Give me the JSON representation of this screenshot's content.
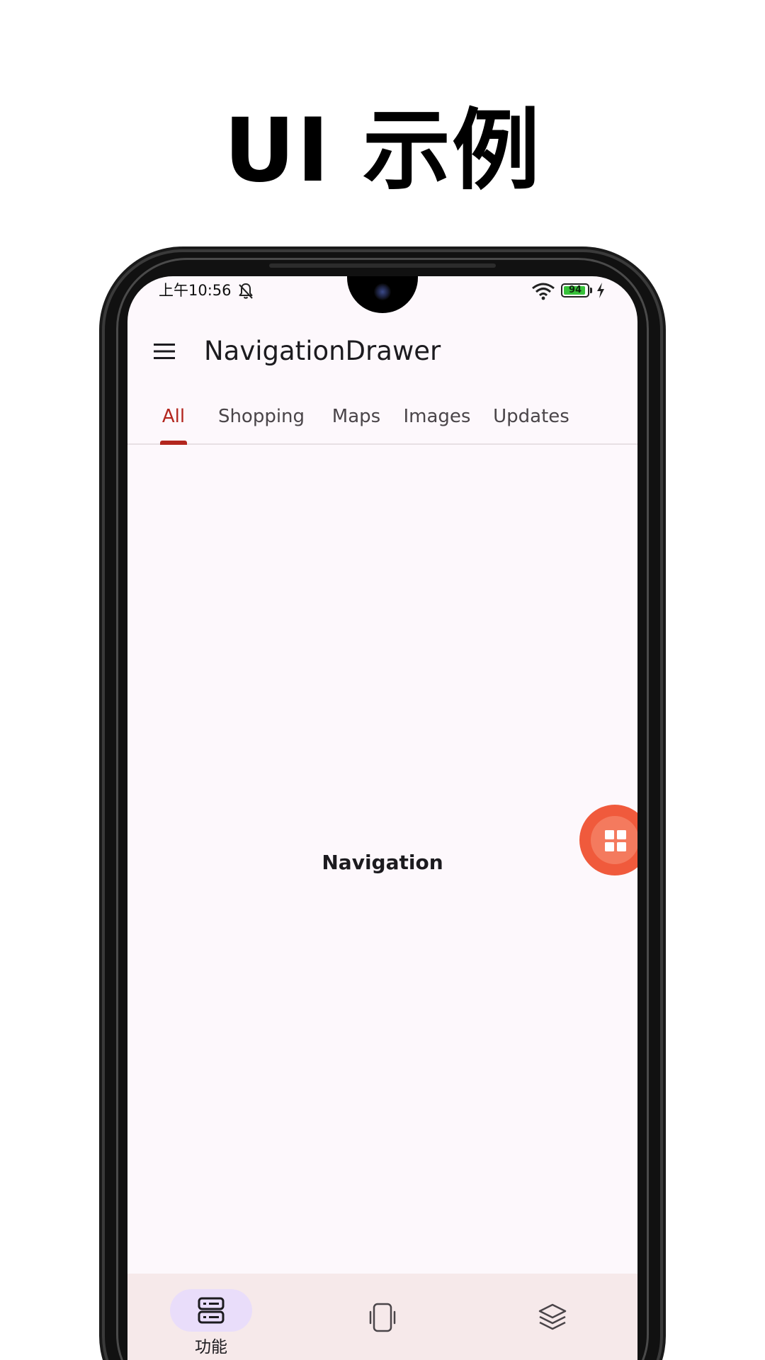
{
  "hero": {
    "title": "UI 示例"
  },
  "status_bar": {
    "time": "上午10:56",
    "battery_level": "94",
    "battery_fraction": 0.94,
    "icons": [
      "bell-off-icon",
      "wifi-icon",
      "battery-icon",
      "charging-icon"
    ]
  },
  "app_bar": {
    "title": "NavigationDrawer",
    "menu_icon": "menu-icon"
  },
  "tabs": {
    "items": [
      {
        "label": "All",
        "selected": true
      },
      {
        "label": "Shopping",
        "selected": false
      },
      {
        "label": "Maps",
        "selected": false
      },
      {
        "label": "Images",
        "selected": false
      },
      {
        "label": "Updates",
        "selected": false
      }
    ]
  },
  "main": {
    "center_text": "Navigation"
  },
  "fab": {
    "icon": "grid-icon"
  },
  "bottom_nav": {
    "items": [
      {
        "label": "功能",
        "icon": "list-icon",
        "selected": true
      },
      {
        "label": "",
        "icon": "phone-icon",
        "selected": false
      },
      {
        "label": "",
        "icon": "layers-icon",
        "selected": false
      }
    ]
  },
  "colors": {
    "accent": "#b3261e",
    "screen_bg": "#fdf8fc",
    "fab": "#f05a3c",
    "bottom_nav_bg": "#f6e9ea",
    "nav_pill": "#e9ddfa"
  }
}
